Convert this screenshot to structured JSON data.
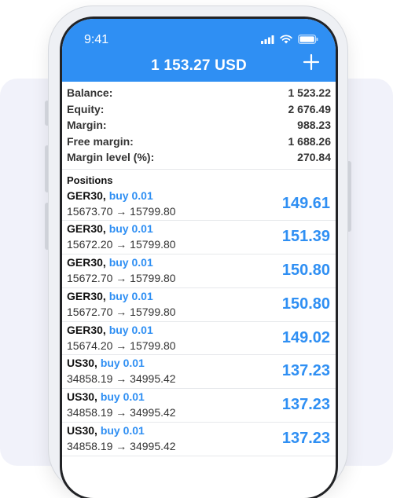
{
  "status_bar": {
    "time": "9:41"
  },
  "header": {
    "balance_title": "1 153.27 USD",
    "add_icon": "plus-icon"
  },
  "account": [
    {
      "label": "Balance:",
      "value": "1 523.22"
    },
    {
      "label": "Equity:",
      "value": "2 676.49"
    },
    {
      "label": "Margin:",
      "value": "988.23"
    },
    {
      "label": "Free margin:",
      "value": "1 688.26"
    },
    {
      "label": "Margin level (%):",
      "value": "270.84"
    }
  ],
  "positions_title": "Positions",
  "positions": [
    {
      "symbol": "GER30,",
      "side": "buy 0.01",
      "prices": "15673.70 → 15799.80",
      "profit": "149.61"
    },
    {
      "symbol": "GER30,",
      "side": "buy 0.01",
      "prices": "15672.20 → 15799.80",
      "profit": "151.39"
    },
    {
      "symbol": "GER30,",
      "side": "buy 0.01",
      "prices": "15672.70 → 15799.80",
      "profit": "150.80"
    },
    {
      "symbol": "GER30,",
      "side": "buy 0.01",
      "prices": "15672.70 → 15799.80",
      "profit": "150.80"
    },
    {
      "symbol": "GER30,",
      "side": "buy 0.01",
      "prices": "15674.20 → 15799.80",
      "profit": "149.02"
    },
    {
      "symbol": "US30,",
      "side": "buy 0.01",
      "prices": "34858.19 → 34995.42",
      "profit": "137.23"
    },
    {
      "symbol": "US30,",
      "side": "buy 0.01",
      "prices": "34858.19 → 34995.42",
      "profit": "137.23"
    },
    {
      "symbol": "US30,",
      "side": "buy 0.01",
      "prices": "34858.19 → 34995.42",
      "profit": "137.23"
    }
  ],
  "colors": {
    "accent": "#2f8ff3",
    "text": "#333333",
    "background": "#f1f2fa"
  }
}
